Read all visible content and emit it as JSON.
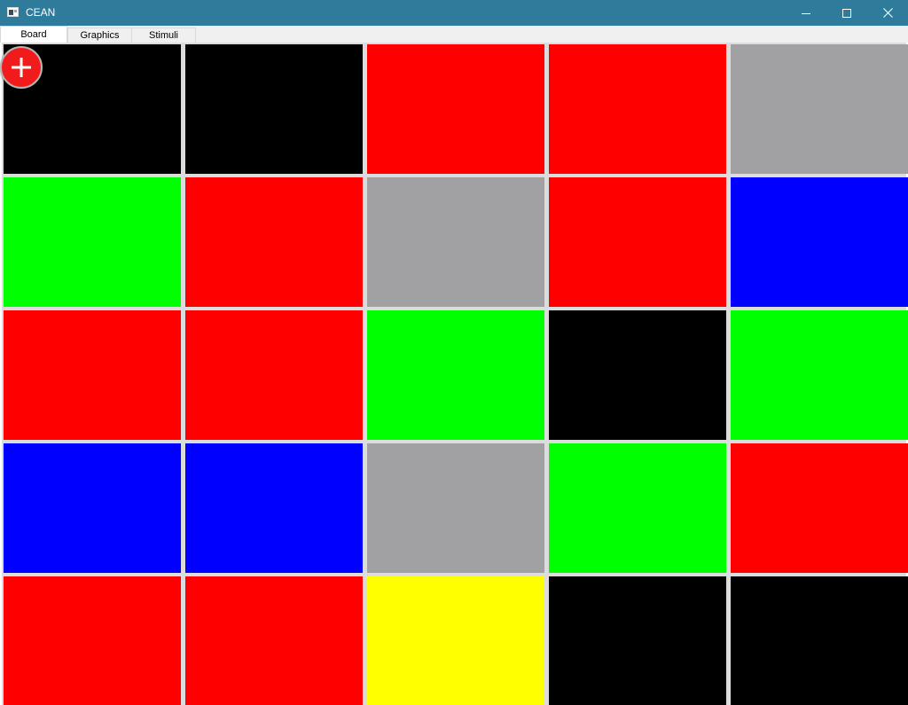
{
  "window": {
    "title": "CEAN",
    "title_bar_color": "#2e7b9c",
    "controls": [
      "minimize-icon",
      "maximize-icon",
      "close-icon"
    ]
  },
  "tabs": [
    {
      "label": "Board",
      "active": true
    },
    {
      "label": "Graphics",
      "active": false
    },
    {
      "label": "Stimuli",
      "active": false
    }
  ],
  "board": {
    "rows": 5,
    "columns": 5,
    "cells": [
      [
        "#000000",
        "#000000",
        "#ff0000",
        "#ff0000",
        "#a1a0a3"
      ],
      [
        "#00ff00",
        "#ff0000",
        "#a1a0a3",
        "#ff0000",
        "#0000ff"
      ],
      [
        "#ff0000",
        "#ff0000",
        "#00ff00",
        "#000000",
        "#00ff00"
      ],
      [
        "#0000ff",
        "#0000ff",
        "#a1a0a3",
        "#00ff00",
        "#ff0000"
      ],
      [
        "#ff0000",
        "#ff0000",
        "#ffff00",
        "#000000",
        "#000000"
      ]
    ]
  },
  "add_button": {
    "icon": "plus-icon",
    "color": "#f21b1b"
  }
}
